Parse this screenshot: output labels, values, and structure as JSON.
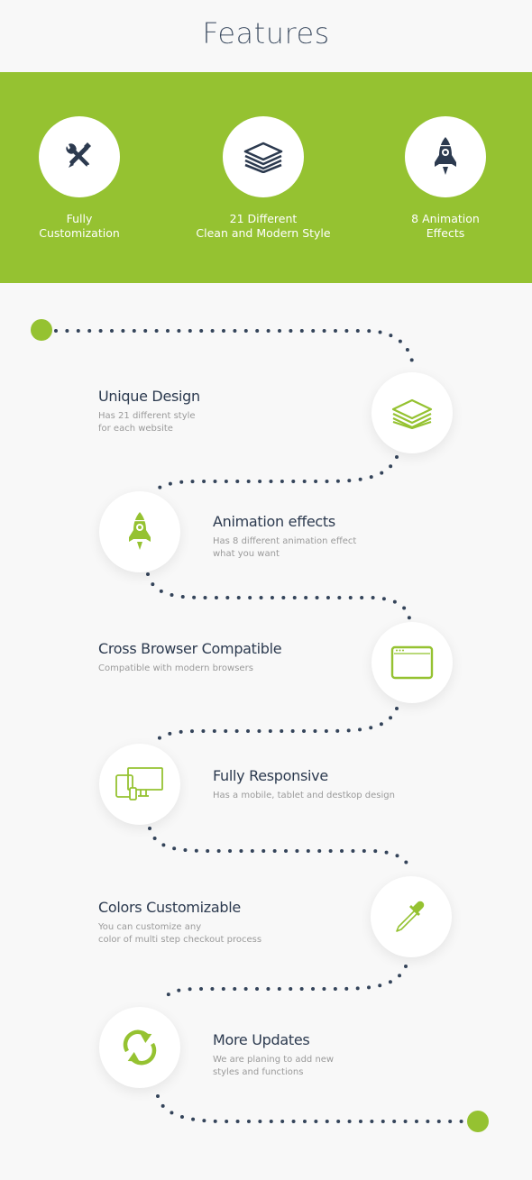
{
  "header": {
    "title": "Features"
  },
  "colors": {
    "accent": "#95c231",
    "dark": "#2c3a4f",
    "muted": "#9a9a9a",
    "background": "#f8f8f8"
  },
  "highlights": [
    {
      "icon": "tools-icon",
      "lines": [
        "Fully",
        "Customization"
      ]
    },
    {
      "icon": "layers-icon",
      "lines": [
        "21 Different",
        "Clean and Modern Style"
      ]
    },
    {
      "icon": "rocket-icon",
      "lines": [
        "8 Animation",
        "Effects"
      ]
    }
  ],
  "features": [
    {
      "icon": "layers-icon",
      "title": "Unique Design",
      "desc": [
        "Has 21 different style",
        "for each website"
      ]
    },
    {
      "icon": "rocket-icon",
      "title": "Animation effects",
      "desc": [
        "Has 8 different animation effect",
        "what you want"
      ]
    },
    {
      "icon": "browser-window-icon",
      "title": "Cross Browser Compatible",
      "desc": [
        "Compatible with modern browsers"
      ]
    },
    {
      "icon": "devices-icon",
      "title": "Fully Responsive",
      "desc": [
        "Has a mobile, tablet and destkop design"
      ]
    },
    {
      "icon": "eyedropper-icon",
      "title": "Colors Customizable",
      "desc": [
        "You can customize any",
        "color of multi step checkout process"
      ]
    },
    {
      "icon": "refresh-icon",
      "title": "More Updates",
      "desc": [
        "We are planing to add new",
        "styles and functions"
      ]
    }
  ]
}
